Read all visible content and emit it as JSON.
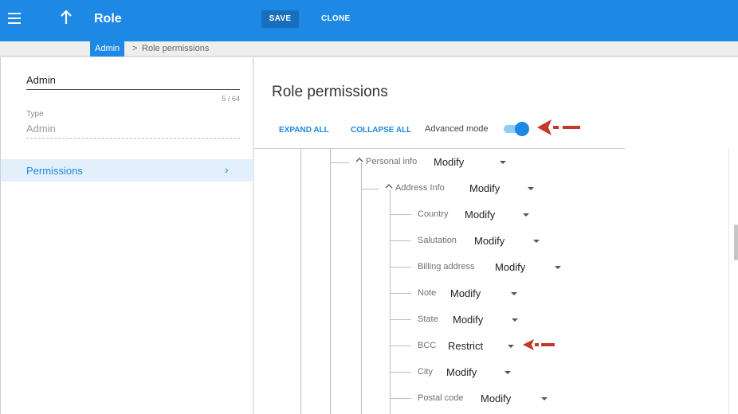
{
  "appbar": {
    "title": "Role",
    "menu_icon": "hamburger-menu-icon",
    "back_icon": "arrow-up-icon",
    "save_label": "SAVE",
    "clone_label": "CLONE",
    "bg_color": "#1e88e5"
  },
  "breadcrumb": {
    "parent": "Admin",
    "separator": ">",
    "current": "Role permissions"
  },
  "left": {
    "name_value": "Admin",
    "name_count": "5 / 64",
    "type_label": "Type",
    "type_value": "Admin",
    "nav_item_label": "Permissions",
    "nav_item_chevron": "›"
  },
  "right": {
    "title": "Role permissions",
    "expand_all": "EXPAND ALL",
    "collapse_all": "COLLAPSE ALL",
    "advanced_mode_label": "Advanced mode",
    "advanced_mode_on": true
  },
  "tree": {
    "personal_info": {
      "label": "Personal info",
      "value": "Modify",
      "caret": "^"
    },
    "address_info": {
      "label": "Address Info",
      "value": "Modify",
      "caret": "^"
    },
    "children": [
      {
        "label": "Country",
        "value": "Modify"
      },
      {
        "label": "Salutation",
        "value": "Modify"
      },
      {
        "label": "Billing address",
        "value": "Modify"
      },
      {
        "label": "Note",
        "value": "Modify"
      },
      {
        "label": "State",
        "value": "Modify"
      },
      {
        "label": "BCC",
        "value": "Restrict"
      },
      {
        "label": "City",
        "value": "Modify"
      },
      {
        "label": "Postal code",
        "value": "Modify"
      }
    ]
  },
  "annotation_color": "#c0392b"
}
